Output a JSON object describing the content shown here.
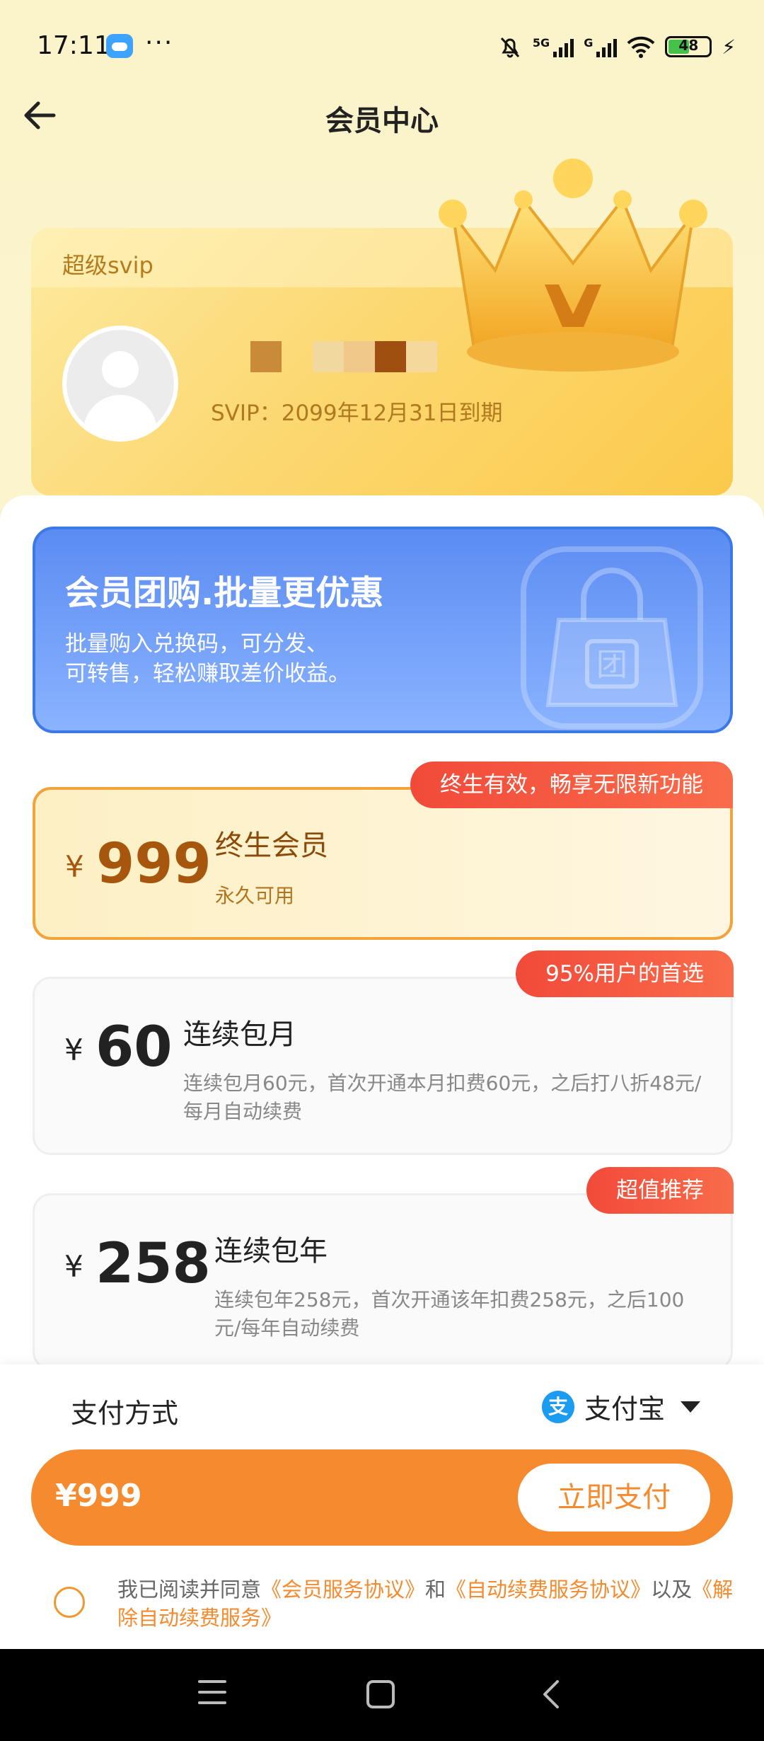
{
  "status_bar": {
    "time": "17:11",
    "dots": "···",
    "network_1": "5G",
    "network_2": "G",
    "battery": "48"
  },
  "header": {
    "title": "会员中心",
    "back_icon": "arrow-left-icon"
  },
  "member_card": {
    "tier": "超级svip",
    "expiry": "SVIP：2099年12月31日到期",
    "username_pixel_colors": [
      "#c98a3a",
      "#f0d89f",
      "#f0c98a",
      "#9f5010",
      "#f5d99c"
    ]
  },
  "group_buy": {
    "title": "会员团购.批量更优惠",
    "desc_line1": "批量购入兑换码，可分发、",
    "desc_line2": "可转售，轻松赚取差价收益。",
    "icon_glyph": "团"
  },
  "plans": [
    {
      "badge": "终生有效，畅享无限新功能",
      "currency": "¥",
      "price": "999",
      "name": "终生会员",
      "desc": "永久可用",
      "selected": true
    },
    {
      "badge": "95%用户的首选",
      "currency": "¥",
      "price": "60",
      "name": "连续包月",
      "desc": "连续包月60元，首次开通本月扣费60元，之后打八折48元/每月自动续费",
      "selected": false
    },
    {
      "badge": "超值推荐",
      "currency": "¥",
      "price": "258",
      "name": "连续包年",
      "desc": "连续包年258元，首次开通该年扣费258元，之后100元/每年自动续费",
      "selected": false
    }
  ],
  "payment": {
    "method_label": "支付方式",
    "method_icon_glyph": "支",
    "method_value": "支付宝",
    "amount": "¥999",
    "pay_button": "立即支付"
  },
  "agreement": {
    "prefix": "我已阅读并同意",
    "link1": "《会员服务协议》",
    "mid1": "和",
    "link2": "《自动续费服务协议》",
    "mid2": "以及",
    "link3": "《解除自动续费服务》"
  },
  "colors": {
    "accent": "#f58b2e",
    "badge_red": "#f24a3a",
    "group_blue": "#5b8cf2",
    "gold": "#fcd872"
  }
}
